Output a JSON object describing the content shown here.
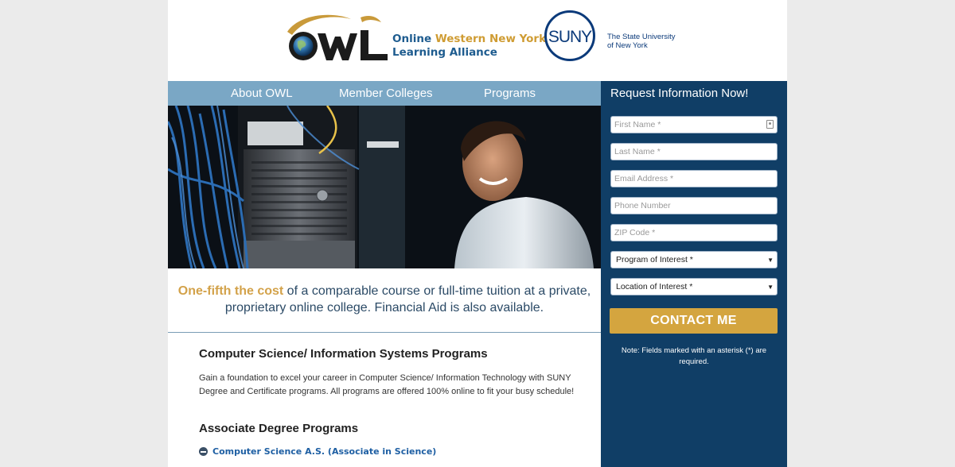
{
  "header": {
    "owl_logo_text": "OWL",
    "owl_name_line1_a": "Online ",
    "owl_name_line1_b": "Western New York",
    "owl_name_line2": "Learning Alliance",
    "suny_logo_text": "SUNY",
    "suny_name_line1": "The State University",
    "suny_name_line2": "of New York"
  },
  "nav": {
    "items": [
      {
        "label": "About OWL"
      },
      {
        "label": "Member Colleges"
      },
      {
        "label": "Programs"
      }
    ]
  },
  "tagline": {
    "highlight": "One-fifth the cost",
    "rest": " of a comparable course or full-time tuition at a private, proprietary online college. Financial Aid is also available."
  },
  "content": {
    "section_title": "Computer Science/ Information Systems Programs",
    "description": "Gain a foundation to excel your career in Computer Science/ Information Technology with SUNY Degree and Certificate programs. All programs are offered 100% online to fit your busy schedule!",
    "associate_title": "Associate Degree Programs",
    "associate_link": "Computer Science A.S. (Associate in Science)"
  },
  "form": {
    "title": "Request Information Now!",
    "first_name_placeholder": "First Name *",
    "last_name_placeholder": "Last Name *",
    "email_placeholder": "Email Address *",
    "phone_placeholder": "Phone Number",
    "zip_placeholder": "ZIP Code *",
    "program_select": "Program of Interest *",
    "location_select": "Location of Interest *",
    "submit_label": "CONTACT ME",
    "note": "Note: Fields marked with an asterisk (*) are required."
  },
  "colors": {
    "page_background": "#ebebeb",
    "nav_background": "#7aa7c5",
    "sidebar_background": "#103e66",
    "button_gold": "#d4a53f",
    "owl_blue": "#1e5c8f",
    "owl_gold": "#cf9c33",
    "link_blue": "#1e5fa3"
  },
  "icons": [
    "owl-globe-icon",
    "suny-circle-icon",
    "autofill-contact-icon",
    "dropdown-arrow-icon",
    "collapse-minus-icon"
  ]
}
